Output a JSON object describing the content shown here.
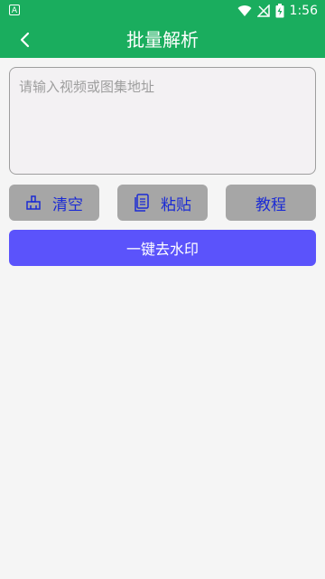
{
  "status_bar": {
    "time": "1:56",
    "left_icon": "A",
    "icons": [
      "wifi-icon",
      "signal-off-icon",
      "battery-charging-icon"
    ]
  },
  "app_bar": {
    "title": "批量解析",
    "back_icon": "chevron-left-icon"
  },
  "input": {
    "placeholder": "请输入视频或图集地址",
    "value": ""
  },
  "buttons": {
    "clear": {
      "label": "清空",
      "icon": "broom-icon"
    },
    "paste": {
      "label": "粘贴",
      "icon": "clipboard-icon"
    },
    "tutorial": {
      "label": "教程"
    },
    "remove_watermark": {
      "label": "一键去水印"
    }
  },
  "colors": {
    "header": "#1aad5e",
    "button_bg": "#a6a6a6",
    "button_text": "#1b2bd4",
    "primary": "#5b53fb",
    "page_bg": "#f5f5f5"
  }
}
